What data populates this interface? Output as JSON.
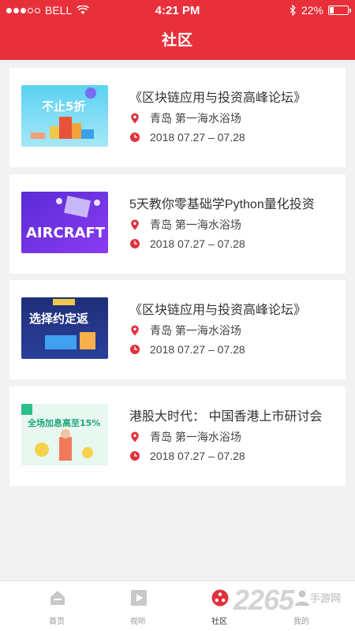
{
  "status_bar": {
    "carrier": "BELL",
    "time": "4:21 PM",
    "battery": "22%",
    "battery_level": 0.22
  },
  "header": {
    "title": "社区"
  },
  "events": [
    {
      "title": "《区块链应用与投资高峰论坛》",
      "location": "青岛  第一海水浴场",
      "date": "2018 07.27 – 07.28",
      "thumb_text": "不止5折"
    },
    {
      "title": "5天教你零基础学Python量化投资",
      "location": "青岛  第一海水浴场",
      "date": "2018 07.27 – 07.28",
      "thumb_text": "AIRCRAFT"
    },
    {
      "title": "《区块链应用与投资高峰论坛》",
      "location": "青岛  第一海水浴场",
      "date": "2018 07.27 – 07.28",
      "thumb_text": "选择约定返"
    },
    {
      "title": "港股大时代：  中国香港上市研讨会",
      "location": "青岛  第一海水浴场",
      "date": "2018 07.27 – 07.28",
      "thumb_text": "全场加息高至15%"
    }
  ],
  "tabs": [
    {
      "label": "首页",
      "icon": "home-icon"
    },
    {
      "label": "视听",
      "icon": "play-icon"
    },
    {
      "label": "社区",
      "icon": "community-icon",
      "active": true
    },
    {
      "label": "我的",
      "icon": "profile-icon"
    }
  ],
  "watermark": {
    "number": "2265",
    "site": "手游网"
  },
  "colors": {
    "accent": "#e8303a"
  }
}
